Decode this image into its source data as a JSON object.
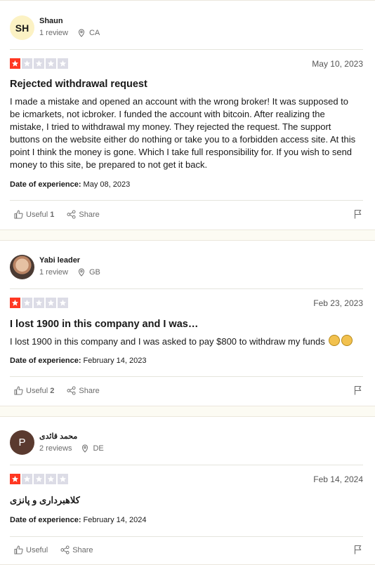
{
  "reviews": [
    {
      "initials": "SH",
      "name": "Shaun",
      "reviews_count": "1 review",
      "country": "CA",
      "rating": 1,
      "date": "May 10, 2023",
      "title": "Rejected withdrawal request",
      "body": "I made a mistake and opened an account with the wrong broker! It was supposed to be icmarkets, not icbroker. I funded the account with bitcoin. After realizing the mistake, I tried to withdrawal my money. They rejected the request. The support buttons on the website either do nothing or take you to a forbidden access site. At this point I think the money is gone. Which I take full responsibility for. If you wish to send money to this site, be prepared to not get it back.",
      "experience_label": "Date of experience:",
      "experience_date": "May 08, 2023",
      "useful_label": "Useful",
      "useful_count": "1",
      "share_label": "Share"
    },
    {
      "initials": "",
      "name": "Yabi leader",
      "reviews_count": "1 review",
      "country": "GB",
      "rating": 1,
      "date": "Feb 23, 2023",
      "title": "I lost 1900 in this company and I was…",
      "body": "I lost 1900 in this company and I was asked to pay $800 to withdraw my funds",
      "experience_label": "Date of experience:",
      "experience_date": "February 14, 2023",
      "useful_label": "Useful",
      "useful_count": "2",
      "share_label": "Share"
    },
    {
      "initials": "P",
      "name": "محمد قائدی",
      "reviews_count": "2 reviews",
      "country": "DE",
      "rating": 1,
      "date": "Feb 14, 2024",
      "title": "کلاهبرداری و پانزی",
      "experience_label": "Date of experience:",
      "experience_date": "February 14, 2024",
      "useful_label": "Useful",
      "useful_count": "",
      "share_label": "Share"
    }
  ],
  "colors": {
    "star_on": "#ff3722",
    "star_off": "#dcdce6",
    "page_bg": "#fcfbf3"
  }
}
